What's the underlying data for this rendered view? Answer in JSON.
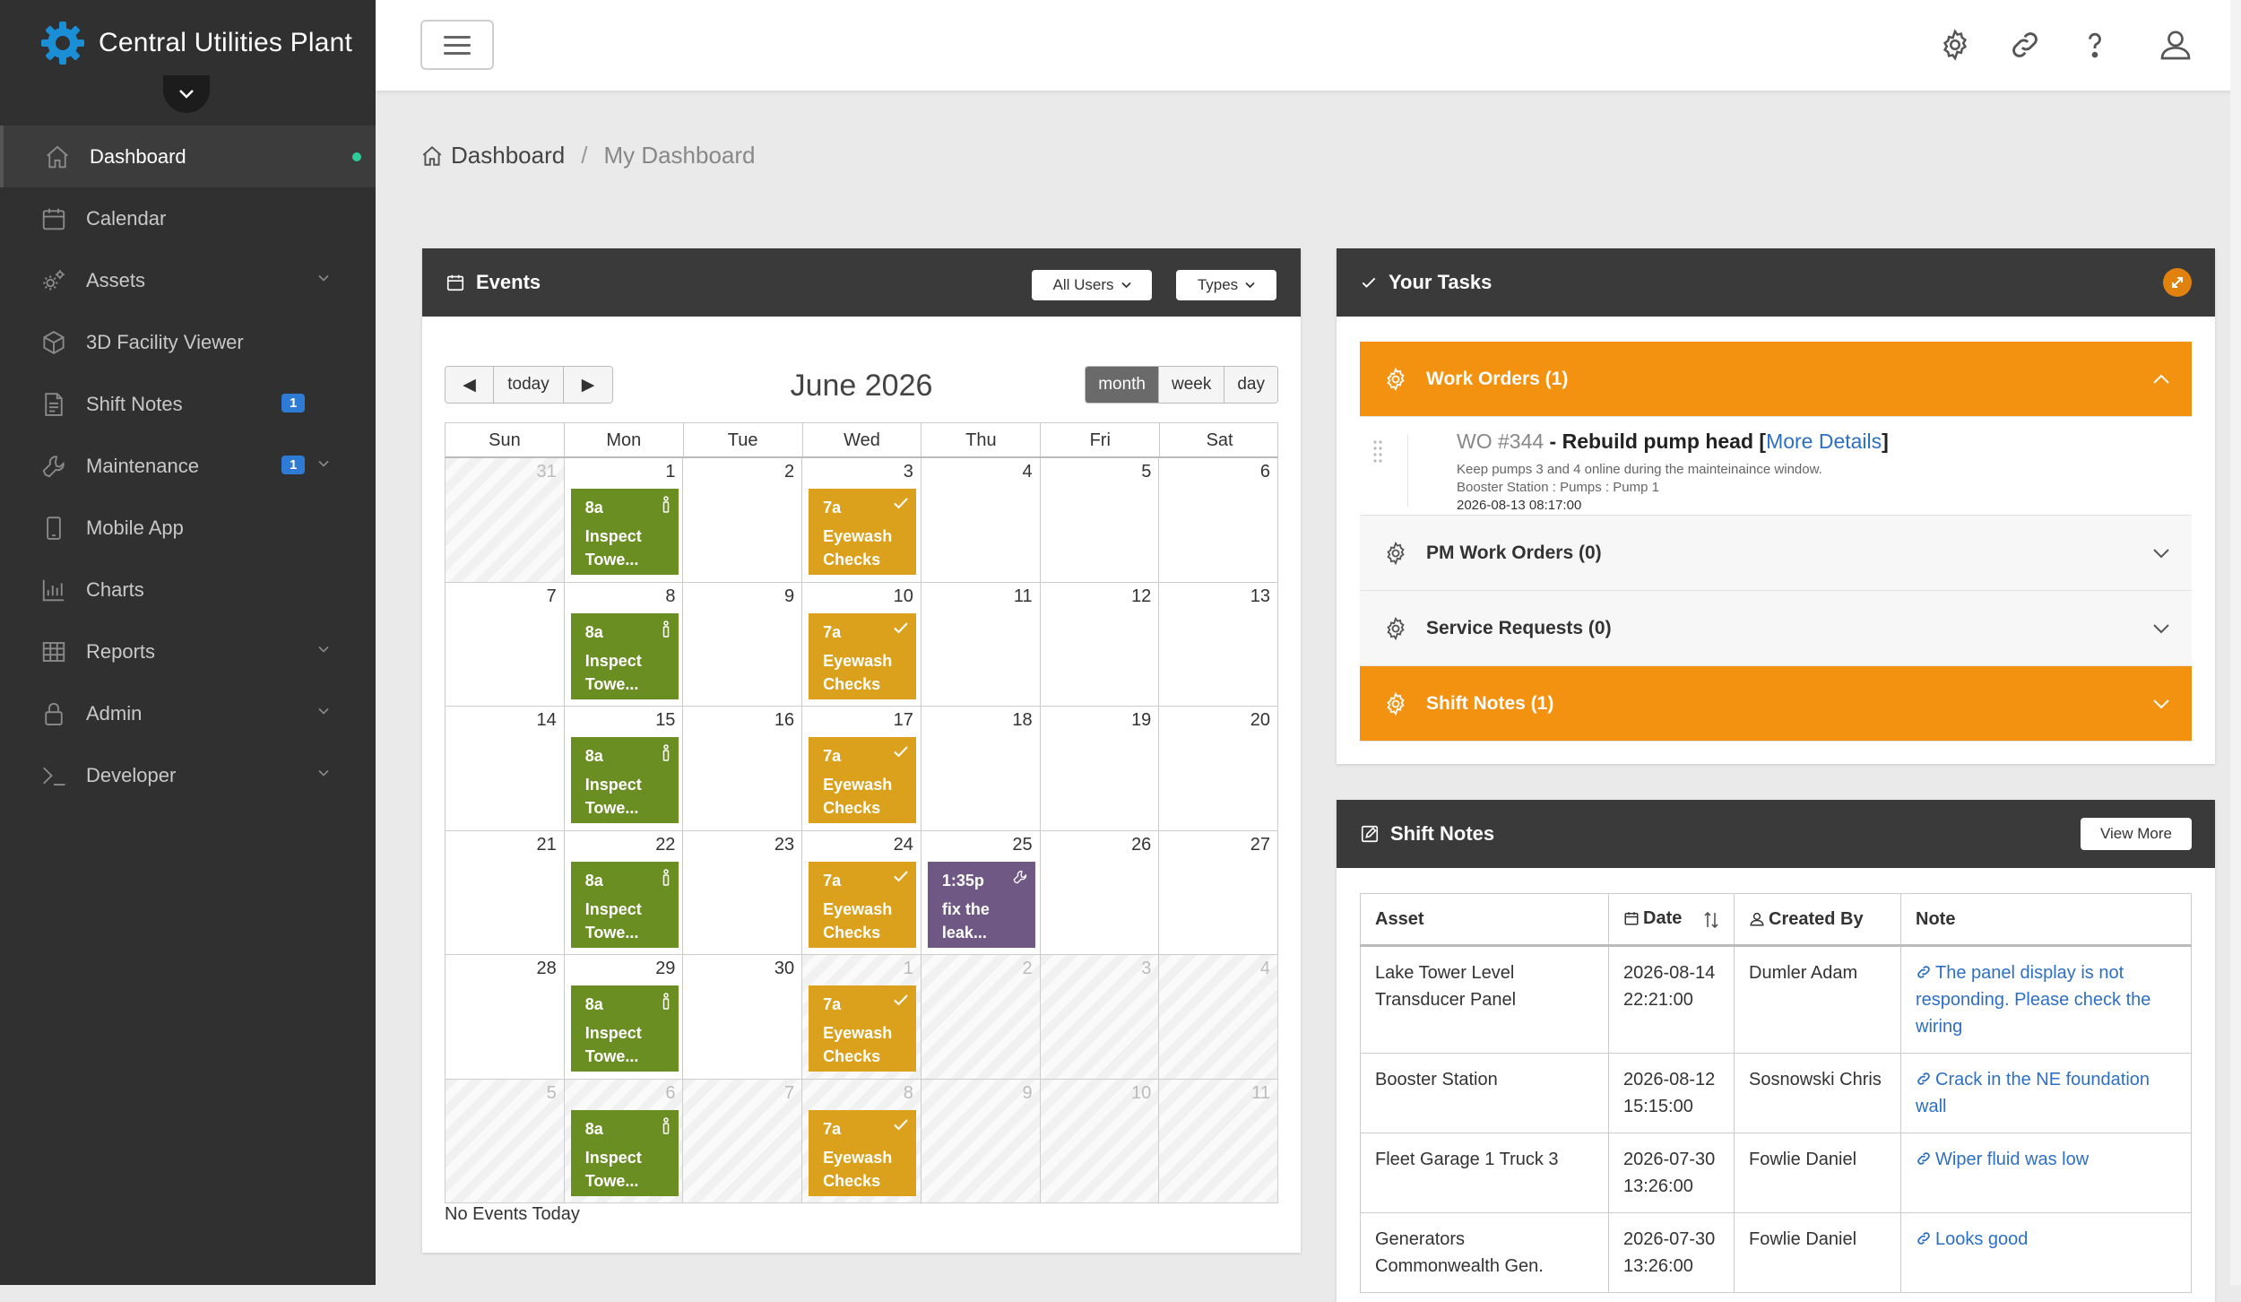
{
  "brand": {
    "name": "Central Utilities Plant",
    "accent": "#1b8fd6"
  },
  "sidebar": {
    "items": [
      {
        "label": "Dashboard",
        "icon": "home-icon",
        "active": true
      },
      {
        "label": "Calendar",
        "icon": "calendar-icon"
      },
      {
        "label": "Assets",
        "icon": "gears-icon",
        "caret": true
      },
      {
        "label": "3D Facility Viewer",
        "icon": "cube-icon"
      },
      {
        "label": "Shift Notes",
        "icon": "notes-icon",
        "badge": "1"
      },
      {
        "label": "Maintenance",
        "icon": "wrench-icon",
        "badge": "1",
        "caret": true
      },
      {
        "label": "Mobile App",
        "icon": "mobile-icon"
      },
      {
        "label": "Charts",
        "icon": "bar-chart-icon"
      },
      {
        "label": "Reports",
        "icon": "table-icon",
        "caret": true
      },
      {
        "label": "Admin",
        "icon": "lock-icon",
        "caret": true
      },
      {
        "label": "Developer",
        "icon": "terminal-icon",
        "caret": true
      }
    ]
  },
  "topbar": {
    "icons": [
      "settings-icon",
      "link-icon",
      "help-icon",
      "user-icon"
    ]
  },
  "breadcrumb": {
    "home": "Dashboard",
    "separator": "/",
    "current": "My Dashboard"
  },
  "events": {
    "title": "Events",
    "filter_users": "All Users",
    "filter_types": "Types",
    "prev": "◀",
    "today": "today",
    "next": "▶",
    "month_title": "June 2026",
    "views": [
      "month",
      "week",
      "day"
    ],
    "active_view": "month",
    "days_of_week": [
      "Sun",
      "Mon",
      "Tue",
      "Wed",
      "Thu",
      "Fri",
      "Sat"
    ],
    "weeks": [
      [
        {
          "d": "31",
          "o": true
        },
        {
          "d": "1",
          "ev": {
            "t": "8a",
            "n": "Inspect Towe...",
            "c": "green",
            "i": "info"
          }
        },
        {
          "d": "2"
        },
        {
          "d": "3",
          "ev": {
            "t": "7a",
            "n": "Eyewash Checks",
            "c": "gold",
            "i": "check"
          }
        },
        {
          "d": "4"
        },
        {
          "d": "5"
        },
        {
          "d": "6"
        }
      ],
      [
        {
          "d": "7"
        },
        {
          "d": "8",
          "ev": {
            "t": "8a",
            "n": "Inspect Towe...",
            "c": "green",
            "i": "info"
          }
        },
        {
          "d": "9"
        },
        {
          "d": "10",
          "ev": {
            "t": "7a",
            "n": "Eyewash Checks",
            "c": "gold",
            "i": "check"
          }
        },
        {
          "d": "11"
        },
        {
          "d": "12"
        },
        {
          "d": "13"
        }
      ],
      [
        {
          "d": "14"
        },
        {
          "d": "15",
          "ev": {
            "t": "8a",
            "n": "Inspect Towe...",
            "c": "green",
            "i": "info"
          }
        },
        {
          "d": "16"
        },
        {
          "d": "17",
          "ev": {
            "t": "7a",
            "n": "Eyewash Checks",
            "c": "gold",
            "i": "check"
          }
        },
        {
          "d": "18"
        },
        {
          "d": "19"
        },
        {
          "d": "20"
        }
      ],
      [
        {
          "d": "21"
        },
        {
          "d": "22",
          "ev": {
            "t": "8a",
            "n": "Inspect Towe...",
            "c": "green",
            "i": "info"
          }
        },
        {
          "d": "23"
        },
        {
          "d": "24",
          "ev": {
            "t": "7a",
            "n": "Eyewash Checks",
            "c": "gold",
            "i": "check"
          }
        },
        {
          "d": "25",
          "ev": {
            "t": "1:35p",
            "n": "fix the leak...",
            "c": "purple",
            "i": "wrench"
          }
        },
        {
          "d": "26"
        },
        {
          "d": "27"
        }
      ],
      [
        {
          "d": "28"
        },
        {
          "d": "29",
          "ev": {
            "t": "8a",
            "n": "Inspect Towe...",
            "c": "green",
            "i": "info"
          }
        },
        {
          "d": "30"
        },
        {
          "d": "1",
          "o": true,
          "ev": {
            "t": "7a",
            "n": "Eyewash Checks",
            "c": "gold",
            "i": "check"
          }
        },
        {
          "d": "2",
          "o": true
        },
        {
          "d": "3",
          "o": true
        },
        {
          "d": "4",
          "o": true
        }
      ],
      [
        {
          "d": "5",
          "o": true
        },
        {
          "d": "6",
          "o": true,
          "ev": {
            "t": "8a",
            "n": "Inspect Towe...",
            "c": "green",
            "i": "info"
          }
        },
        {
          "d": "7",
          "o": true
        },
        {
          "d": "8",
          "o": true,
          "ev": {
            "t": "7a",
            "n": "Eyewash Checks",
            "c": "gold",
            "i": "check"
          }
        },
        {
          "d": "9",
          "o": true
        },
        {
          "d": "10",
          "o": true
        },
        {
          "d": "11",
          "o": true
        }
      ]
    ],
    "no_events": "No Events Today"
  },
  "tasks": {
    "title": "Your Tasks",
    "work_orders": {
      "label": "Work Orders (1)",
      "item": {
        "number": "WO #344",
        "dash": " - ",
        "title": "Rebuild pump head",
        "more_open": " [",
        "more": "More Details",
        "more_close": "]",
        "description": "Keep pumps 3 and 4 online during the mainteinaince window.",
        "location": "Booster Station : Pumps : Pump 1",
        "date": "2026-08-13 08:17:00"
      }
    },
    "pm_work_orders": "PM Work Orders (0)",
    "service_requests": "Service Requests (0)",
    "shift_notes": "Shift Notes (1)"
  },
  "shift_notes": {
    "title": "Shift Notes",
    "view_more": "View More",
    "columns": [
      "Asset",
      "Date",
      "Created By",
      "Note"
    ],
    "rows": [
      {
        "asset": "Lake Tower Level Transducer Panel",
        "date": "2026-08-14 22:21:00",
        "created_by": "Dumler Adam",
        "note": "The panel display is not responding. Please check the wiring"
      },
      {
        "asset": "Booster Station",
        "date": "2026-08-12 15:15:00",
        "created_by": "Sosnowski Chris",
        "note": "Crack in the NE foundation wall"
      },
      {
        "asset": "Fleet Garage 1 Truck 3",
        "date": "2026-07-30 13:26:00",
        "created_by": "Fowlie Daniel",
        "note": "Wiper fluid was low"
      },
      {
        "asset": "Generators Commonwealth Gen.",
        "date": "2026-07-30 13:26:00",
        "created_by": "Fowlie Daniel",
        "note": "Looks good"
      }
    ]
  },
  "colors": {
    "orange": "#f39110",
    "event_green": "#6b8e23",
    "event_gold": "#dba11d",
    "event_purple": "#6f5884",
    "link": "#2d6fc4"
  }
}
